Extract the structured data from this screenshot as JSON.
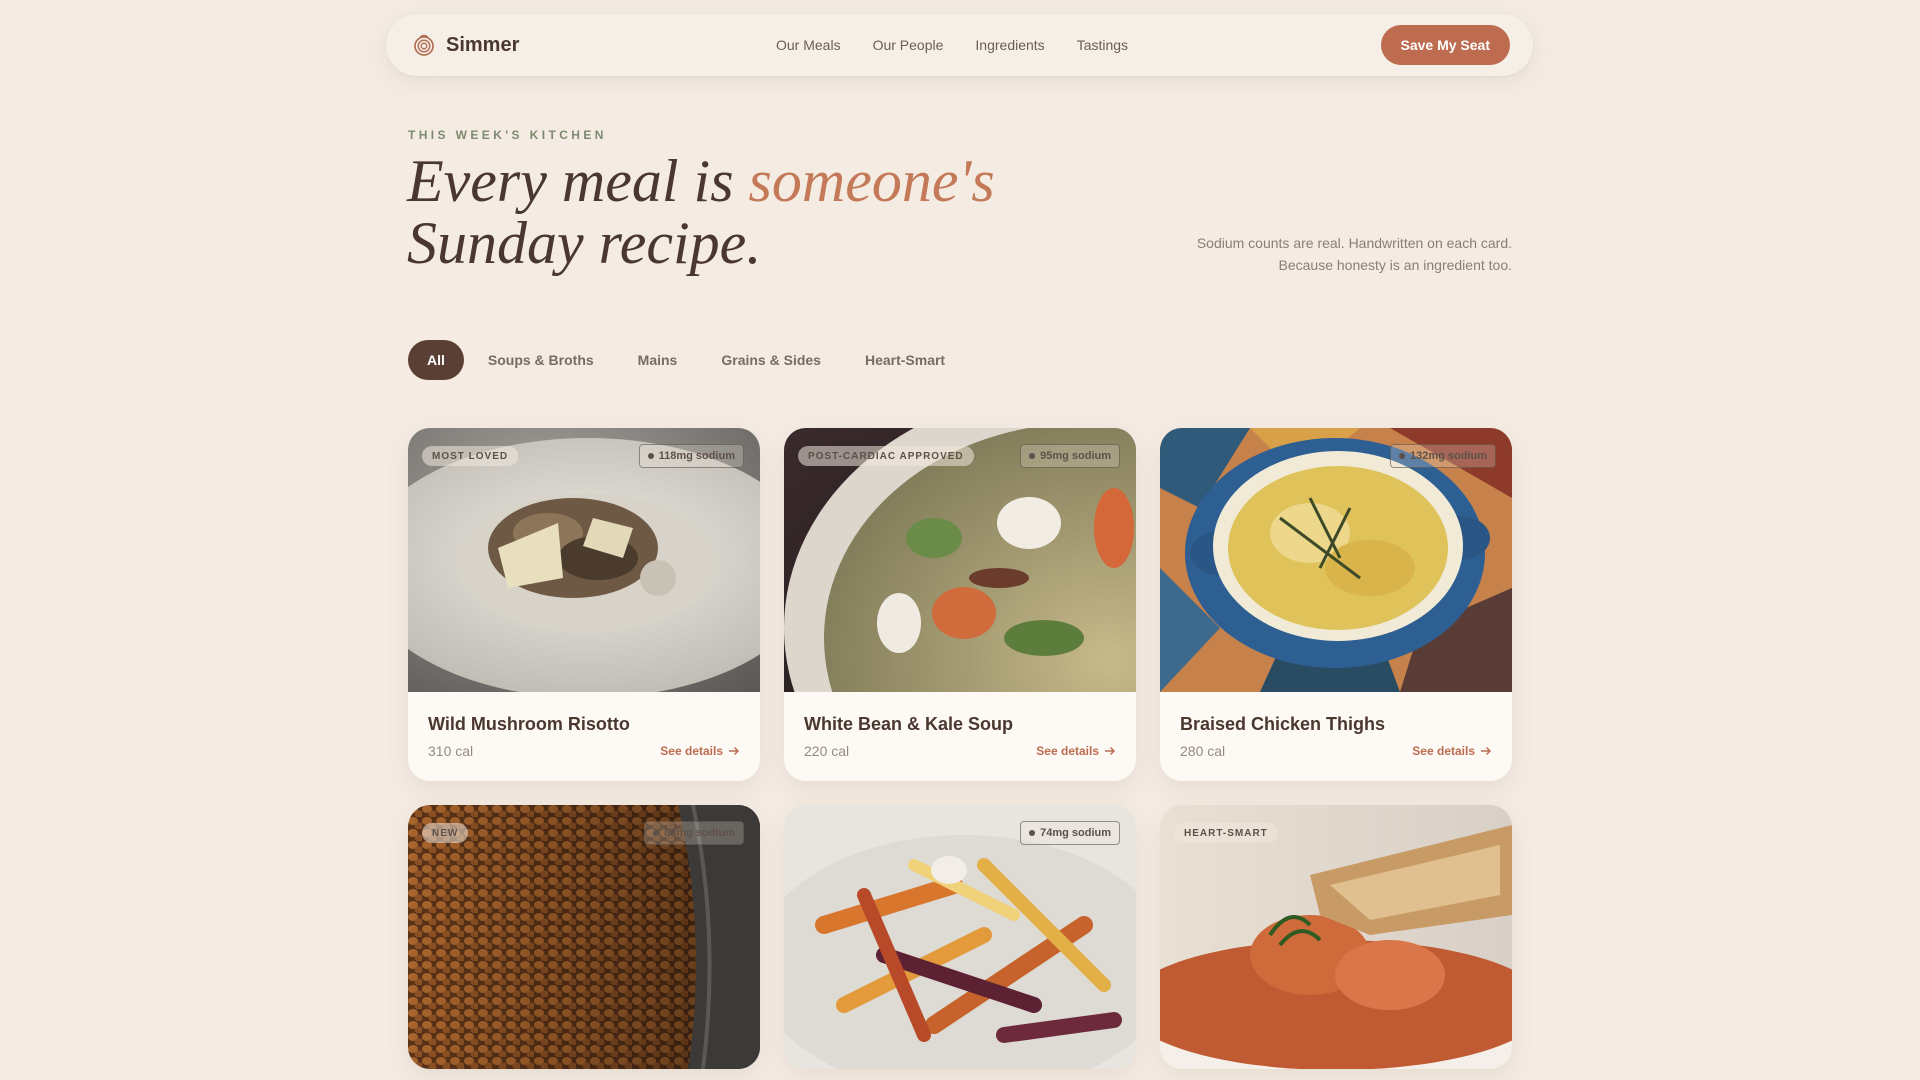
{
  "brand": {
    "name": "Simmer",
    "icon": "spiral-pot-icon"
  },
  "nav": {
    "links": [
      "Our Meals",
      "Our People",
      "Ingredients",
      "Tastings"
    ],
    "cta": "Save My Seat"
  },
  "hero": {
    "eyebrow": "THIS WEEK'S KITCHEN",
    "headline_part1": "Every meal is ",
    "headline_accent": "someone's",
    "headline_part2": "Sunday recipe.",
    "note_line1": "Sodium counts are real. Handwritten on each card.",
    "note_line2": "Because honesty is an ingredient too."
  },
  "filters": [
    "All",
    "Soups & Broths",
    "Mains",
    "Grains & Sides",
    "Heart-Smart"
  ],
  "active_filter": "All",
  "colors": {
    "accent": "#bd6c50",
    "dark": "#5a3f35",
    "background": "#f4ece3",
    "sage": "#7d8a6f"
  },
  "meals": [
    {
      "title": "Wild Mushroom Risotto",
      "cal": "310 cal",
      "tag": "MOST LOVED",
      "sodium": "118mg sodium",
      "link": "See details",
      "image": "mushroom-risotto-photo"
    },
    {
      "title": "White Bean & Kale Soup",
      "cal": "220 cal",
      "tag": "POST-CARDIAC APPROVED",
      "sodium": "95mg sodium",
      "link": "See details",
      "image": "vegetable-soup-photo"
    },
    {
      "title": "Braised Chicken Thighs",
      "cal": "280 cal",
      "tag": "",
      "sodium": "132mg sodium",
      "link": "See details",
      "image": "baked-dish-photo"
    },
    {
      "title": "",
      "cal": "",
      "tag": "NEW",
      "sodium": "88mg sodium",
      "link": "",
      "image": "lentils-photo"
    },
    {
      "title": "",
      "cal": "",
      "tag": "",
      "sodium": "74mg sodium",
      "link": "",
      "image": "roasted-root-vegetables-photo"
    },
    {
      "title": "",
      "cal": "",
      "tag": "HEART-SMART",
      "sodium": "",
      "link": "",
      "image": "seafood-stew-photo"
    }
  ]
}
